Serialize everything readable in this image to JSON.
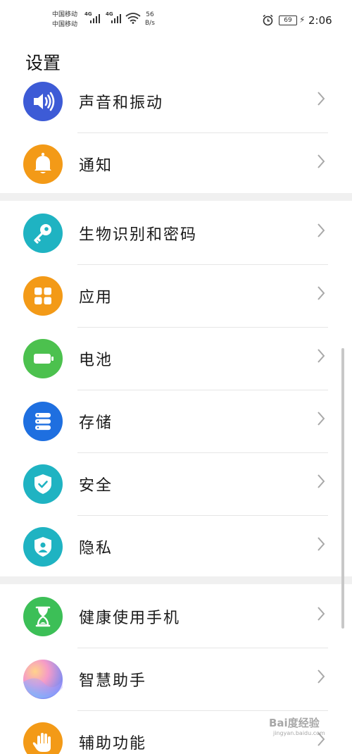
{
  "status": {
    "carrier1": "中国移动",
    "carrier2": "中国移动",
    "net1": "4G",
    "net2": "4G",
    "speed_value": "56",
    "speed_unit": "B/s",
    "battery": "69",
    "time": "2:06"
  },
  "page": {
    "title": "设置"
  },
  "items": [
    {
      "label": "声音和振动",
      "icon": "speaker-icon",
      "color": "#3d5bd6"
    },
    {
      "label": "通知",
      "icon": "bell-icon",
      "color": "#f39a17"
    },
    {
      "label": "生物识别和密码",
      "icon": "key-icon",
      "color": "#1fb3c2"
    },
    {
      "label": "应用",
      "icon": "apps-grid-icon",
      "color": "#f39a17"
    },
    {
      "label": "电池",
      "icon": "battery-icon",
      "color": "#4cc14e"
    },
    {
      "label": "存储",
      "icon": "storage-icon",
      "color": "#1e6fe0"
    },
    {
      "label": "安全",
      "icon": "shield-check-icon",
      "color": "#1fb3c2"
    },
    {
      "label": "隐私",
      "icon": "privacy-shield-icon",
      "color": "#1fb3c2"
    },
    {
      "label": "健康使用手机",
      "icon": "hourglass-icon",
      "color": "#3cbf57"
    },
    {
      "label": "智慧助手",
      "icon": "assistant-orb-icon",
      "color": "#9b8ff0"
    },
    {
      "label": "辅助功能",
      "icon": "hand-icon",
      "color": "#f39a17"
    }
  ],
  "watermark": {
    "brand": "Bai度经验",
    "url": "jingyan.baidu.com"
  }
}
